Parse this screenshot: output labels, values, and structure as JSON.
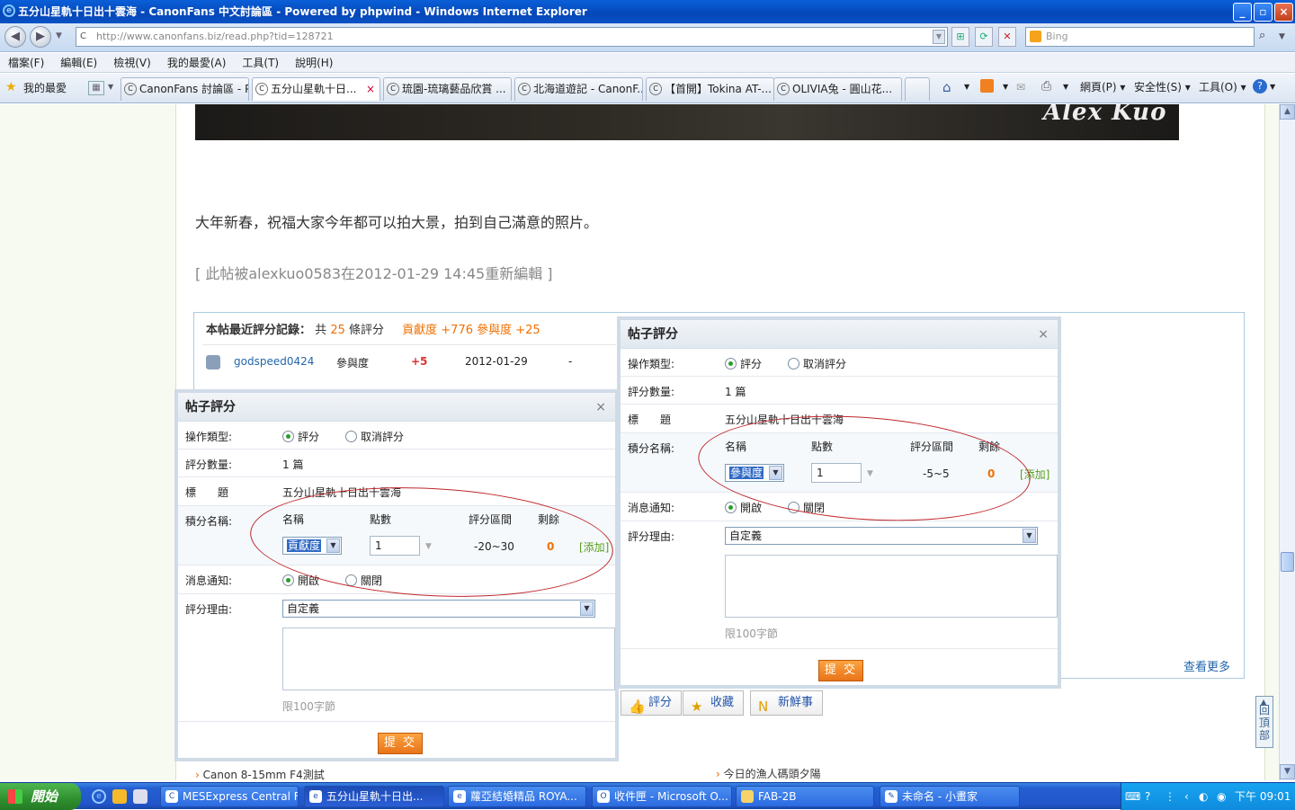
{
  "window": {
    "title": "五分山星軌十日出十雲海 - CanonFans 中文討論區 - Powered by phpwind - Windows Internet Explorer"
  },
  "address": {
    "url": "http://www.canonfans.biz/read.php?tid=128721",
    "search_placeholder": "Bing"
  },
  "menu": [
    "檔案(F)",
    "編輯(E)",
    "檢視(V)",
    "我的最愛(A)",
    "工具(T)",
    "說明(H)"
  ],
  "favorites_label": "我的最愛",
  "tabs": [
    {
      "label": "CanonFans 討論區 - P..."
    },
    {
      "label": "五分山星軌十日..."
    },
    {
      "label": "琉園-琉璃藝品欣賞 ..."
    },
    {
      "label": "北海道遊記 - CanonF..."
    },
    {
      "label": "【首開】Tokina AT-..."
    },
    {
      "label": "OLIVIA兔 - 圓山花..."
    }
  ],
  "toolbar": {
    "page": "網頁(P)",
    "safety": "安全性(S)",
    "tools": "工具(O)"
  },
  "post": {
    "watermark": "Alex Kuo",
    "greeting": "大年新春，祝福大家今年都可以拍大景，拍到自己滿意的照片。",
    "edited": "[ 此帖被alexkuo0583在2012-01-29 14:45重新編輯 ]"
  },
  "rating_log": {
    "title": "本帖最近評分記錄：",
    "count_prefix": "共",
    "count": "25",
    "count_suffix": "條評分",
    "summary": "貢獻度 +776 參與度 +25",
    "rows": [
      {
        "user": "godspeed0424",
        "type": "參與度",
        "score": "+5",
        "date": "2012-01-29",
        "note": "-"
      }
    ],
    "see_more": "查看更多"
  },
  "actions": [
    "評分",
    "收藏",
    "新鮮事"
  ],
  "links": [
    "Canon 8-15mm F4測試",
    "今日的漁人碼頭夕陽"
  ],
  "backtop": "回頂部",
  "dialog_left": {
    "title": "帖子評分",
    "close": "×",
    "op_label": "操作類型:",
    "op_opt1": "評分",
    "op_opt2": "取消評分",
    "count_label": "評分數量:",
    "count_value": "1 篇",
    "subject_label": "標　　題",
    "subject_value": "五分山星軌十日出十雲海",
    "points_label": "積分名稱:",
    "col_name": "名稱",
    "col_points": "點數",
    "col_range": "評分區間",
    "col_remain": "剩餘",
    "name_value": "貢獻度",
    "points_value": "1",
    "range_value": "-20~30",
    "remain_value": "0",
    "add": "[添加]",
    "notify_label": "消息通知:",
    "notify_on": "開啟",
    "notify_off": "關閉",
    "reason_label": "評分理由:",
    "reason_value": "自定義",
    "limit": "限100字節",
    "submit": "提 交"
  },
  "dialog_right": {
    "title": "帖子評分",
    "close": "×",
    "op_label": "操作類型:",
    "op_opt1": "評分",
    "op_opt2": "取消評分",
    "count_label": "評分數量:",
    "count_value": "1 篇",
    "subject_label": "標　　題",
    "subject_value": "五分山星軌十日出十雲海",
    "points_label": "積分名稱:",
    "col_name": "名稱",
    "col_points": "點數",
    "col_range": "評分區間",
    "col_remain": "剩餘",
    "name_value": "參與度",
    "points_value": "1",
    "range_value": "-5~5",
    "remain_value": "0",
    "add": "[添加]",
    "notify_label": "消息通知:",
    "notify_on": "開啟",
    "notify_off": "關閉",
    "reason_label": "評分理由:",
    "reason_value": "自定義",
    "limit": "限100字節",
    "submit": "提 交"
  },
  "taskbar": {
    "start": "開始",
    "items": [
      "MESExpress Central F...",
      "五分山星軌十日出...",
      "蘿亞結婚精品 ROYA...",
      "收件匣 - Microsoft O...",
      "FAB-2B",
      "未命名 - 小畫家"
    ],
    "clock": "下午 09:01"
  },
  "colors": {
    "accent": "#f07000",
    "link": "#2266aa",
    "submit": "#f08a24",
    "annotation": "#c0262a"
  }
}
